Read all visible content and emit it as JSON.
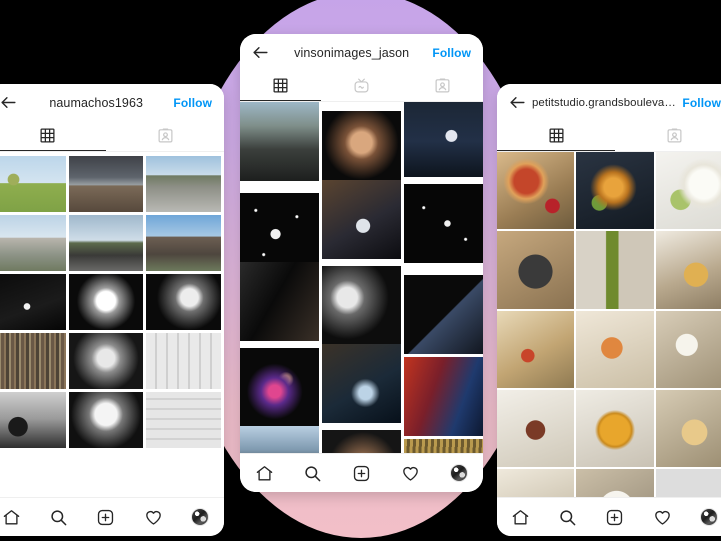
{
  "background": {
    "page_color": "#000000",
    "blob_gradient_top": "#c6a4e9",
    "blob_gradient_bottom": "#f2bfc8"
  },
  "theme": {
    "accent_follow": "#0095f6",
    "text_primary": "#262626",
    "icon_inactive": "#c7c7c7",
    "card_bg": "#ffffff"
  },
  "phones": [
    {
      "id": "phone-left",
      "header": {
        "back_icon": "back-arrow-icon",
        "handle": "naumachos1963",
        "follow_label": "Follow"
      },
      "tabs": [
        {
          "icon": "grid-icon",
          "label": "Posts",
          "active": true
        },
        {
          "icon": "tagged-icon",
          "label": "Tagged",
          "active": false
        }
      ],
      "grid": {
        "columns": 3,
        "style": "spaced",
        "cells": [
          {
            "name": "photo-tree-field",
            "art": "p-sky-tree"
          },
          {
            "name": "photo-storm-dirt-road",
            "art": "p-dirt-storm"
          },
          {
            "name": "photo-city-street",
            "art": "p-street"
          },
          {
            "name": "photo-warehouse",
            "art": "p-warehouse"
          },
          {
            "name": "photo-dome-building",
            "art": "p-dome"
          },
          {
            "name": "photo-apartment-tower",
            "art": "p-tower"
          },
          {
            "name": "photo-bw-dark-flowers",
            "art": "p-bwdark1"
          },
          {
            "name": "photo-bw-bright-tree",
            "art": "p-bwdark2"
          },
          {
            "name": "photo-bw-branches",
            "art": "p-bwdark3"
          },
          {
            "name": "photo-bookshelf",
            "art": "p-books"
          },
          {
            "name": "photo-bw-portrait",
            "art": "p-bwportrait"
          },
          {
            "name": "photo-gallery-wall",
            "art": "p-gallery"
          },
          {
            "name": "photo-bw-vintage-car",
            "art": "p-bwcar"
          },
          {
            "name": "photo-bw-helmet",
            "art": "p-bwhat"
          },
          {
            "name": "photo-bw-interior-room",
            "art": "p-bwroom"
          }
        ]
      },
      "bottom_nav": [
        {
          "icon": "home-icon",
          "label": "Home"
        },
        {
          "icon": "search-icon",
          "label": "Search"
        },
        {
          "icon": "add-post-icon",
          "label": "New post"
        },
        {
          "icon": "heart-icon",
          "label": "Activity"
        },
        {
          "icon": "profile-avatar-icon",
          "label": "Profile"
        }
      ]
    },
    {
      "id": "phone-center",
      "header": {
        "back_icon": "back-arrow-icon",
        "handle": "vinsonimages_jason",
        "follow_label": "Follow"
      },
      "tabs": [
        {
          "icon": "grid-icon",
          "label": "Posts",
          "active": true
        },
        {
          "icon": "igtv-icon",
          "label": "IGTV",
          "active": false
        },
        {
          "icon": "tagged-icon",
          "label": "Tagged",
          "active": false
        }
      ],
      "grid": {
        "columns": 3,
        "style": "staggered",
        "cells": [
          {
            "name": "photo-protest-crowd",
            "art": "c-protest",
            "offset": "offA"
          },
          {
            "name": "photo-man-portrait",
            "art": "c-portrait",
            "offset": "offB"
          },
          {
            "name": "photo-dancer-stage",
            "art": "c-dancer",
            "offset": "offC"
          },
          {
            "name": "photo-night-sky-moon",
            "art": "c-night-sky",
            "offset": "offB"
          },
          {
            "name": "photo-hands-table",
            "art": "c-hands",
            "offset": "offC"
          },
          {
            "name": "photo-night-sky-stars",
            "art": "c-night-sky2",
            "offset": "offA"
          },
          {
            "name": "photo-film-crew",
            "art": "c-crew",
            "offset": "offC"
          },
          {
            "name": "photo-bw-two-men",
            "art": "c-bwmen",
            "offset": "offA"
          },
          {
            "name": "photo-flag-building",
            "art": "c-flag",
            "offset": "offB"
          },
          {
            "name": "photo-neon-performer",
            "art": "c-neon",
            "offset": "offA"
          },
          {
            "name": "photo-skater-leap",
            "art": "c-skater",
            "offset": "offC"
          },
          {
            "name": "photo-red-stage-light",
            "art": "c-redstage",
            "offset": "offB"
          },
          {
            "name": "photo-bicycle-clouds",
            "art": "c-bike",
            "offset": "offC"
          },
          {
            "name": "photo-couple-embrace",
            "art": "c-couple",
            "offset": "offA"
          },
          {
            "name": "photo-gold-dress-woman",
            "art": "c-golddress",
            "offset": "offB"
          }
        ]
      },
      "bottom_nav": [
        {
          "icon": "home-icon",
          "label": "Home"
        },
        {
          "icon": "search-icon",
          "label": "Search"
        },
        {
          "icon": "add-post-icon",
          "label": "New post"
        },
        {
          "icon": "heart-icon",
          "label": "Activity"
        },
        {
          "icon": "profile-avatar-icon",
          "label": "Profile"
        }
      ]
    },
    {
      "id": "phone-right",
      "header": {
        "back_icon": "back-arrow-icon",
        "handle": "petitstudio.grandsboulevards",
        "follow_label": "Follow"
      },
      "tabs": [
        {
          "icon": "grid-icon",
          "label": "Posts",
          "active": true
        },
        {
          "icon": "tagged-icon",
          "label": "Tagged",
          "active": false
        }
      ],
      "grid": {
        "columns": 3,
        "style": "tight",
        "cells": [
          {
            "name": "photo-pizza-board",
            "art": "f-pizza"
          },
          {
            "name": "photo-roast-vegetables",
            "art": "f-roast"
          },
          {
            "name": "photo-burrata-salad",
            "art": "f-burrata"
          },
          {
            "name": "photo-skillet-dish",
            "art": "f-skillet"
          },
          {
            "name": "photo-olive-oil-bottle",
            "art": "f-bottle"
          },
          {
            "name": "photo-fries-wine",
            "art": "f-fries"
          },
          {
            "name": "photo-sandwich-baguette",
            "art": "f-sandwich"
          },
          {
            "name": "photo-smoked-toast",
            "art": "f-toast"
          },
          {
            "name": "photo-cheese-board",
            "art": "f-cheese"
          },
          {
            "name": "photo-steak-plate",
            "art": "f-steak"
          },
          {
            "name": "photo-carrot-soup",
            "art": "f-soup"
          },
          {
            "name": "photo-pasta-bowl",
            "art": "f-pasta"
          },
          {
            "name": "photo-salmon-dish",
            "art": "f-salmon"
          },
          {
            "name": "photo-white-plate-meal",
            "art": "f-plate"
          },
          {
            "name": "photo-dessert-drink",
            "art": "f-dessert"
          }
        ]
      },
      "bottom_nav": [
        {
          "icon": "home-icon",
          "label": "Home"
        },
        {
          "icon": "search-icon",
          "label": "Search"
        },
        {
          "icon": "add-post-icon",
          "label": "New post"
        },
        {
          "icon": "heart-icon",
          "label": "Activity"
        },
        {
          "icon": "profile-avatar-icon",
          "label": "Profile"
        }
      ]
    }
  ]
}
